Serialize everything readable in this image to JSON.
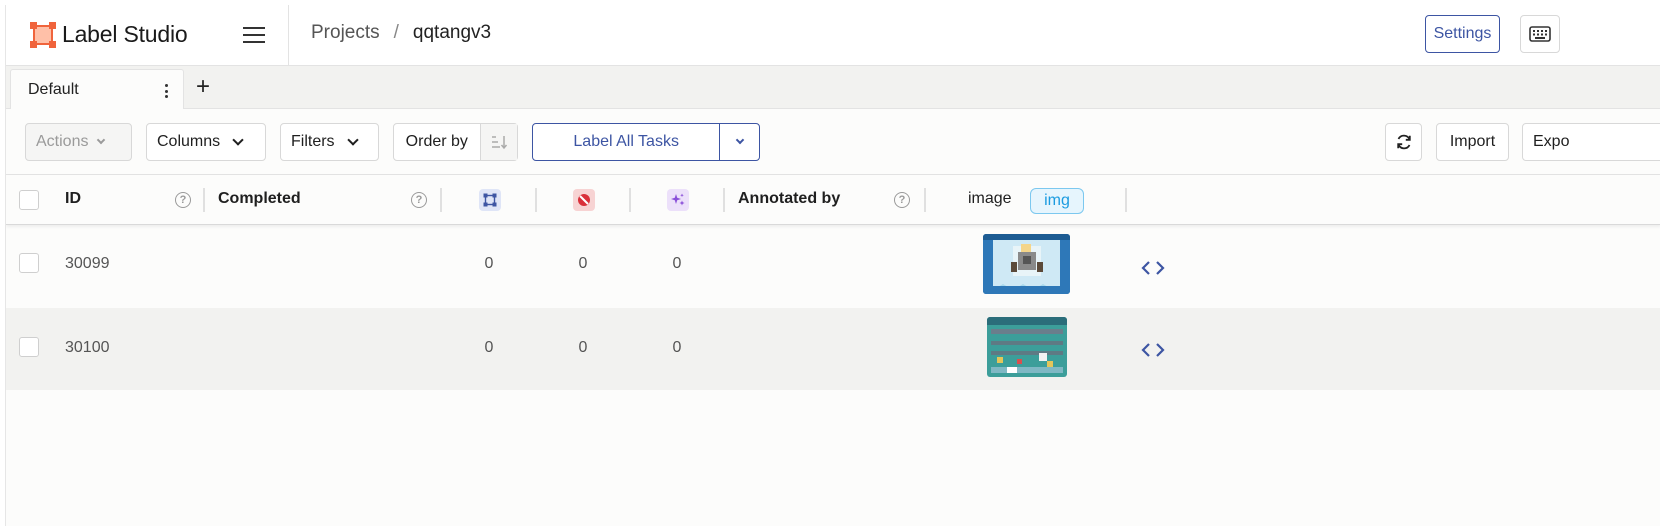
{
  "app": {
    "name": "Label Studio",
    "logo_icon": "label-studio-logo",
    "accent": "#f0643c"
  },
  "breadcrumb": {
    "projects": "Projects",
    "separator": "/",
    "current": "qqtangv3"
  },
  "header": {
    "settings_label": "Settings",
    "keyboard_icon": "keyboard-icon"
  },
  "tabs": [
    {
      "label": "Default"
    }
  ],
  "toolbar": {
    "actions_label": "Actions",
    "columns_label": "Columns",
    "filters_label": "Filters",
    "order_by_label": "Order by",
    "label_all_label": "Label All Tasks",
    "import_label": "Import",
    "export_label": "Expo"
  },
  "table": {
    "columns": {
      "id": "ID",
      "completed": "Completed",
      "annotated_by": "Annotated by",
      "image": "image",
      "image_tag": "img"
    },
    "header_icons": {
      "annotations": {
        "icon": "annotations-icon",
        "color": "#3d55a3",
        "bg": "#dfe5f7"
      },
      "cancelled": {
        "icon": "cancelled-icon",
        "color": "#d9303a",
        "bg": "#f7d3d3"
      },
      "predictions": {
        "icon": "predictions-icon",
        "color": "#8a4fd9",
        "bg": "#ece0fa"
      }
    },
    "rows": [
      {
        "id": "30099",
        "annotations": "0",
        "cancelled": "0",
        "predictions": "0",
        "thumbnail": "game-screenshot-ice-level"
      },
      {
        "id": "30100",
        "annotations": "0",
        "cancelled": "0",
        "predictions": "0",
        "thumbnail": "game-screenshot-water-level"
      }
    ]
  }
}
